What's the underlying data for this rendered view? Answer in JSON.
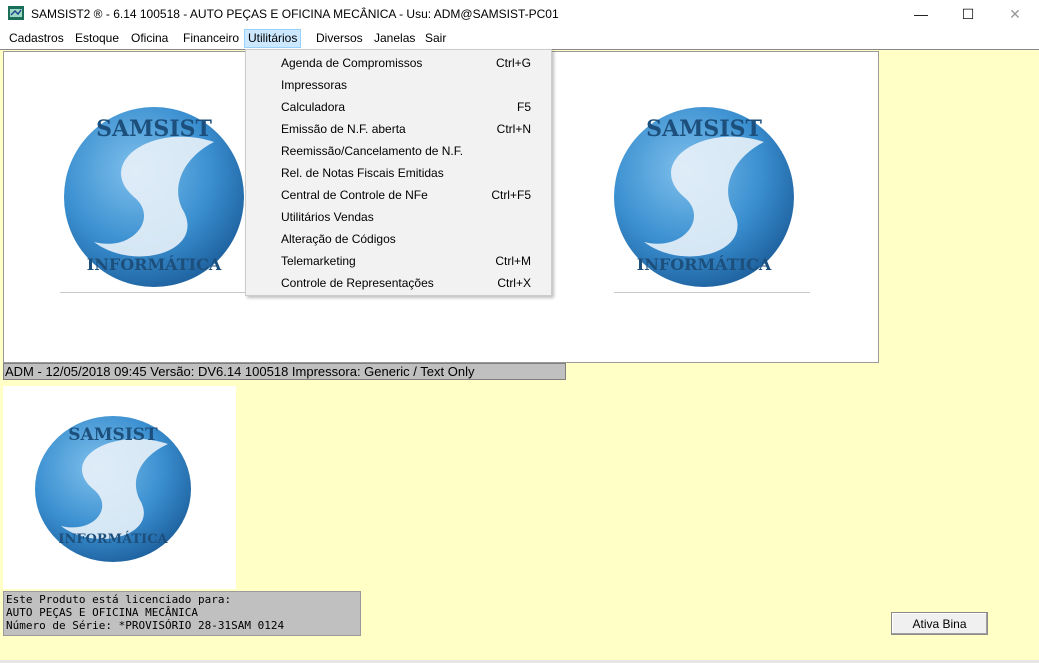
{
  "window": {
    "title": "SAMSIST2 ® - 6.14  100518 - AUTO PEÇAS E OFICINA MECÂNICA - Usu: ADM@SAMSIST-PC01",
    "minimize_glyph": "—",
    "maximize_glyph": "☐",
    "close_glyph": "✕"
  },
  "menu": {
    "items": [
      {
        "label": "Cadastros"
      },
      {
        "label": "Estoque"
      },
      {
        "label": "Oficina"
      },
      {
        "label": "Financeiro"
      },
      {
        "label": "Utilitários"
      },
      {
        "label": "Diversos"
      },
      {
        "label": "Janelas"
      },
      {
        "label": "Sair"
      }
    ],
    "active": "Utilitários"
  },
  "dropdown": {
    "items": [
      {
        "label": "Agenda de Compromissos",
        "shortcut": "Ctrl+G"
      },
      {
        "label": "Impressoras",
        "shortcut": ""
      },
      {
        "label": "Calculadora",
        "shortcut": "F5"
      },
      {
        "label": "Emissão de N.F. aberta",
        "shortcut": "Ctrl+N"
      },
      {
        "label": "Reemissão/Cancelamento de N.F.",
        "shortcut": ""
      },
      {
        "label": "Rel. de Notas Fiscais Emitidas",
        "shortcut": ""
      },
      {
        "label": "Central de Controle de  NFe",
        "shortcut": "Ctrl+F5"
      },
      {
        "label": "Utilitários Vendas",
        "shortcut": ""
      },
      {
        "label": "Alteração de Códigos",
        "shortcut": ""
      },
      {
        "label": "Telemarketing",
        "shortcut": "Ctrl+M"
      },
      {
        "label": "Controle de Representações",
        "shortcut": "Ctrl+X"
      }
    ]
  },
  "logo": {
    "top_text": "SAMSIST",
    "bottom_text": "INFORMÁTICA"
  },
  "status": {
    "text": "ADM - 12/05/2018  09:45 Versão: DV6.14  100518   Impressora: Generic / Text Only"
  },
  "license": {
    "line1": "Este Produto está licenciado para:",
    "line2": "AUTO PEÇAS E OFICINA MECÂNICA",
    "line3": "Número de Série: *PROVISÓRIO 28-31SAM    0124"
  },
  "buttons": {
    "ativa_bina": "Ativa Bina"
  },
  "colors": {
    "client_bg": "#ffffc6",
    "menu_active": "#cce8ff",
    "logo_blue": "#3a8fd0"
  }
}
